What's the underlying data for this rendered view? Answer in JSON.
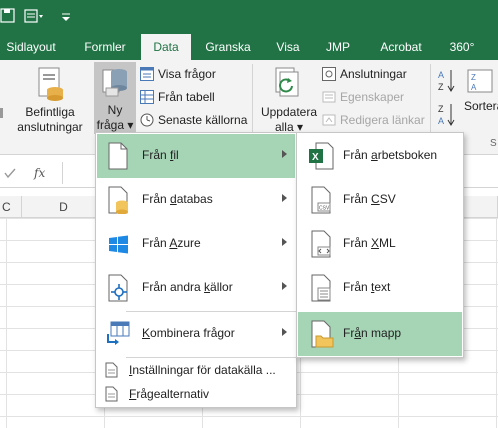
{
  "ribbon_tabs": [
    {
      "label": "Sidlayout",
      "active": false
    },
    {
      "label": "Formler",
      "active": false
    },
    {
      "label": "Data",
      "active": true
    },
    {
      "label": "Granska",
      "active": false
    },
    {
      "label": "Visa",
      "active": false
    },
    {
      "label": "JMP",
      "active": false
    },
    {
      "label": "Acrobat",
      "active": false
    },
    {
      "label": "360°",
      "active": false
    }
  ],
  "ribbon": {
    "existing_connections": {
      "line1": "Befintliga",
      "line2": "anslutningar"
    },
    "new_query": {
      "line1": "Ny",
      "line2": "fråga"
    },
    "show_queries": "Visa frågor",
    "from_table": "Från tabell",
    "recent_sources": "Senaste källorna",
    "refresh_all": {
      "line1": "Uppdatera",
      "line2": "alla"
    },
    "connections": "Anslutningar",
    "properties": "Egenskaper",
    "edit_links": "Redigera länkar",
    "sort_label": "Sortera"
  },
  "formula_bar": {
    "fx": "fx"
  },
  "columns": [
    "C",
    "D"
  ],
  "menu": {
    "items": [
      {
        "name": "from-file",
        "pre": "Från ",
        "acc": "f",
        "post": "il",
        "highlighted": true,
        "submenu": true
      },
      {
        "name": "from-database",
        "pre": "Från ",
        "acc": "d",
        "post": "atabas",
        "highlighted": false,
        "submenu": true
      },
      {
        "name": "from-azure",
        "pre": "Från ",
        "acc": "A",
        "post": "zure",
        "highlighted": false,
        "submenu": true
      },
      {
        "name": "from-other-sources",
        "pre": "Från andra ",
        "acc": "k",
        "post": "ällor",
        "highlighted": false,
        "submenu": true
      },
      {
        "name": "combine-queries",
        "pre": "",
        "acc": "K",
        "post": "ombinera frågor",
        "highlighted": false,
        "submenu": true
      }
    ],
    "small_items": [
      {
        "name": "data-source-settings",
        "pre": "",
        "acc": "I",
        "post": "nställningar för datakälla ..."
      },
      {
        "name": "query-options",
        "pre": "",
        "acc": "F",
        "post": "rågealternativ"
      }
    ]
  },
  "submenu": {
    "items": [
      {
        "name": "from-workbook",
        "pre": "Från ",
        "acc": "a",
        "post": "rbetsboken",
        "highlighted": false
      },
      {
        "name": "from-csv",
        "pre": "Från ",
        "acc": "C",
        "post": "SV",
        "highlighted": false
      },
      {
        "name": "from-xml",
        "pre": "Från ",
        "acc": "X",
        "post": "ML",
        "highlighted": false
      },
      {
        "name": "from-text",
        "pre": "Från ",
        "acc": "t",
        "post": "ext",
        "highlighted": false
      },
      {
        "name": "from-folder",
        "pre": "Fr",
        "acc": "å",
        "post": "n mapp",
        "highlighted": true
      }
    ]
  },
  "colors": {
    "accent": "#217346",
    "highlight": "#a6d5b6",
    "ribbon_bg": "#f3f3f3"
  }
}
